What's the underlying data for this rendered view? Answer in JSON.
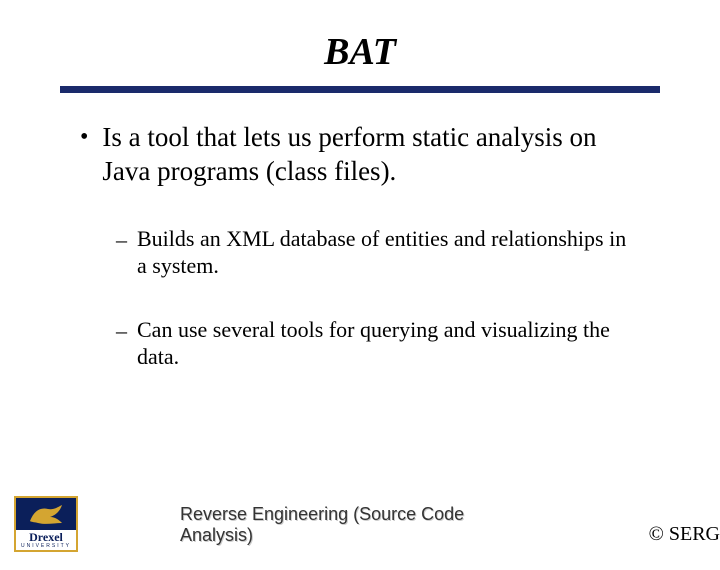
{
  "title": "BAT",
  "bullets": {
    "main": "Is a tool that lets us perform static analysis on Java programs (class files).",
    "sub1": "Builds an XML database of entities and relationships in a system.",
    "sub2": "Can use several tools for querying and visualizing the data."
  },
  "footer": {
    "center": "Reverse Engineering (Source Code Analysis)",
    "right": "© SERG"
  },
  "logo": {
    "name": "Drexel",
    "sub": "UNIVERSITY"
  }
}
